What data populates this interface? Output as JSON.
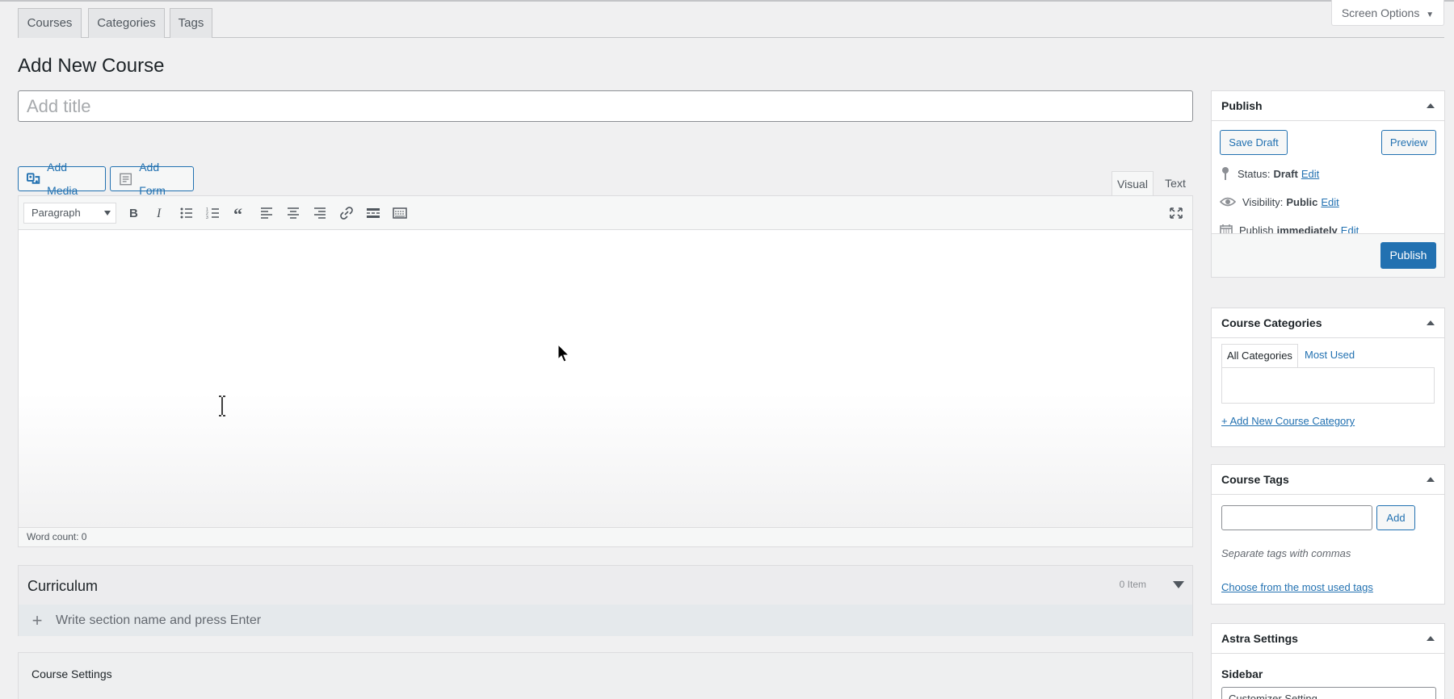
{
  "nav_tabs": [
    "Courses",
    "Categories",
    "Tags"
  ],
  "screen_options": "Screen Options",
  "page_title": "Add New Course",
  "title_placeholder": "Add title",
  "media_buttons": {
    "add_media": "Add Media",
    "add_form": "Add Form"
  },
  "editor": {
    "tabs": {
      "visual": "Visual",
      "text": "Text"
    },
    "format": "Paragraph",
    "toolbar_icons": [
      "bold-icon",
      "italic-icon",
      "bullet-list-icon",
      "numbered-list-icon",
      "blockquote-icon",
      "align-left-icon",
      "align-center-icon",
      "align-right-icon",
      "link-icon",
      "read-more-icon",
      "toolbar-toggle-icon",
      "fullscreen-icon"
    ],
    "word_count": "Word count: 0"
  },
  "curriculum": {
    "title": "Curriculum",
    "count": "0 Item",
    "placeholder": "Write section name and press Enter"
  },
  "course_settings": {
    "title": "Course Settings"
  },
  "publish": {
    "title": "Publish",
    "save_draft": "Save Draft",
    "preview": "Preview",
    "status_label": "Status:",
    "status_value": "Draft",
    "visibility_label": "Visibility:",
    "visibility_value": "Public",
    "publish_label": "Publish",
    "publish_value": "immediately",
    "edit": "Edit",
    "publish_button": "Publish"
  },
  "categories": {
    "title": "Course Categories",
    "tab_all": "All Categories",
    "tab_most_used": "Most Used",
    "add_new": "+ Add New Course Category"
  },
  "tags": {
    "title": "Course Tags",
    "add_button": "Add",
    "hint": "Separate tags with commas",
    "choose": "Choose from the most used tags"
  },
  "astra": {
    "title": "Astra Settings",
    "sidebar_label": "Sidebar",
    "sidebar_value": "Customizer Setting"
  },
  "colors": {
    "accent": "#2271b1",
    "background": "#f0f0f1",
    "primary_button": "#2271b1"
  }
}
